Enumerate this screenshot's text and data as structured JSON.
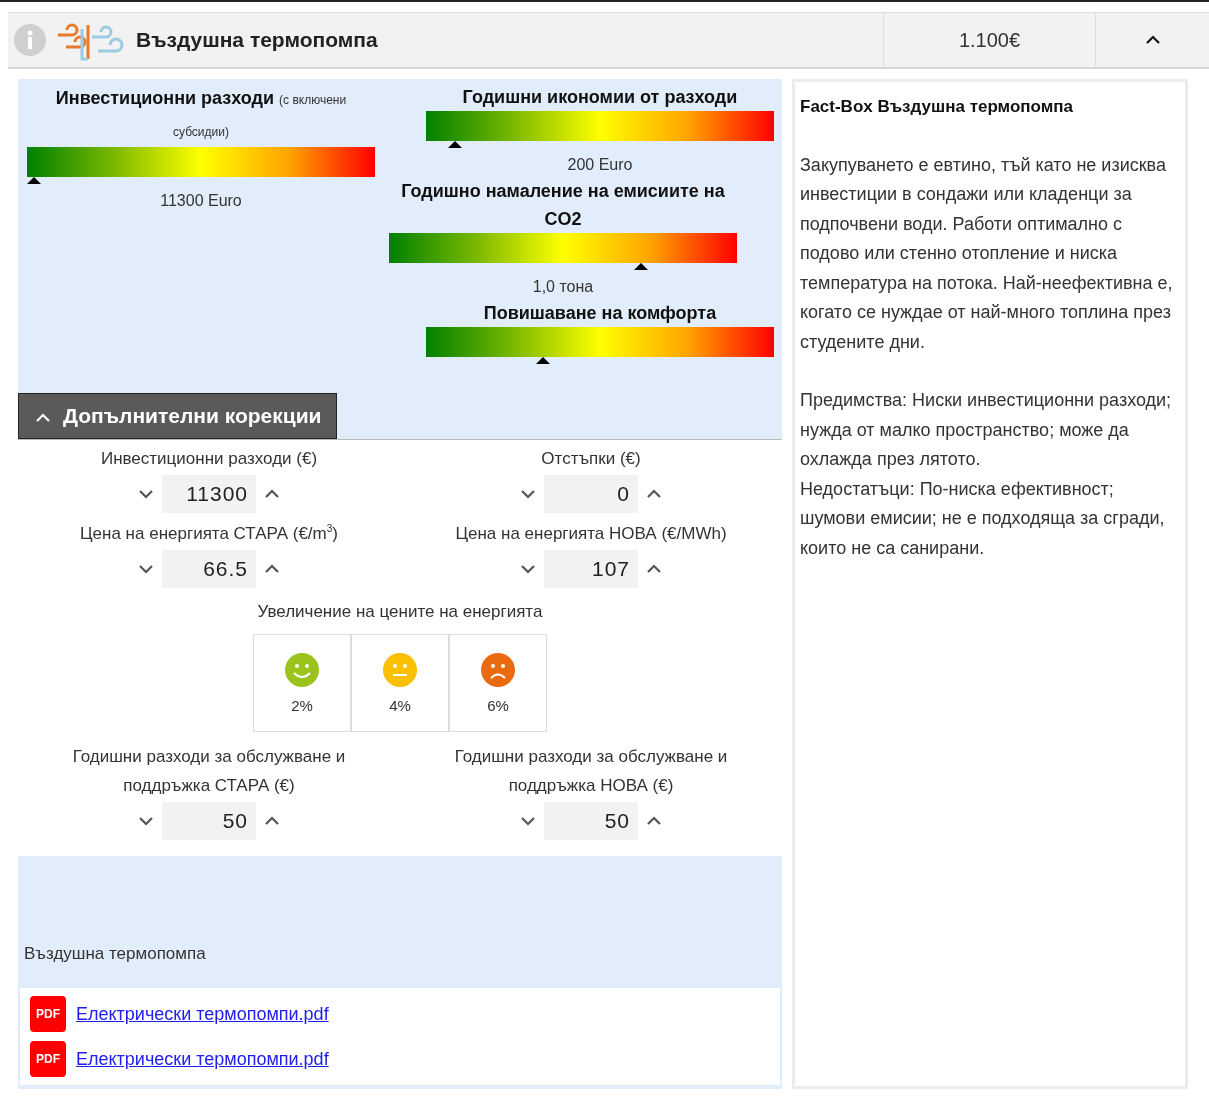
{
  "header": {
    "title": "Въздушна термопомпа",
    "price": "1.100€",
    "expanded": true
  },
  "gauges": [
    {
      "title": "Инвестиционни разходи",
      "note": "(с включени субсидии)",
      "level": 0.0,
      "reading": "11300 Euro"
    },
    {
      "title": "Годишни икономии от разходи",
      "level": 0.066,
      "reading": "200 Euro"
    },
    {
      "title": "Годишно намаление на емисиите на CO2",
      "level": 0.735,
      "reading": "1,0 тона"
    },
    {
      "title": "Повишаване на комфорта",
      "level": 0.33
    }
  ],
  "corrections": {
    "title": "Допълнителни корекции",
    "expanded": true,
    "fields": [
      {
        "label": "Инвестиционни разходи (€)",
        "value": "11300"
      },
      {
        "label": "Отстъпки (€)",
        "value": "0"
      },
      {
        "label": "Цена на енергията СТАРА (€/m$^{3}$)",
        "value": "66.5"
      },
      {
        "label": "Цена на енергията НОВА (€/MWh)",
        "value": "107"
      }
    ],
    "price_increase": {
      "label": "Увеличение на цените на енергията",
      "options": [
        {
          "kind": "happy",
          "color": "#9ac31c",
          "label": "2%"
        },
        {
          "kind": "neutral",
          "color": "#f9c000",
          "label": "4%"
        },
        {
          "kind": "sad",
          "color": "#ea6a10",
          "label": "6%"
        }
      ]
    },
    "maintenance": [
      {
        "label": "Годишни разходи за обслужване и поддръжка СТАРА (€)",
        "value": "50"
      },
      {
        "label": "Годишни разходи за обслужване и поддръжка НОВА (€)",
        "value": "50"
      }
    ]
  },
  "documents": {
    "title": "Въздушна термопомпа",
    "files": [
      {
        "badge": "PDF",
        "name": "Електрически термопомпи.pdf"
      },
      {
        "badge": "PDF",
        "name": "Електрически термопомпи.pdf"
      }
    ]
  },
  "fact_box": {
    "title": "Fact-Box Въздушна термопомпа",
    "paragraphs": [
      "Закупуването е евтино, тъй като не изисква инвестиции в сондажи или кладенци за подпочвени води. Работи оптимално с подово или стенно отопление и ниска температура на потока. Най-неефективна е, когато се нуждае от най-много топлина през студените дни.",
      "Предимства: Ниски инвестиционни разходи; нужда от малко пространство; може да охлажда през лятото.",
      "Недостатъци: По-ниска ефективност; шумови емисии; не е подходяща за сгради, които не са санирани."
    ]
  }
}
